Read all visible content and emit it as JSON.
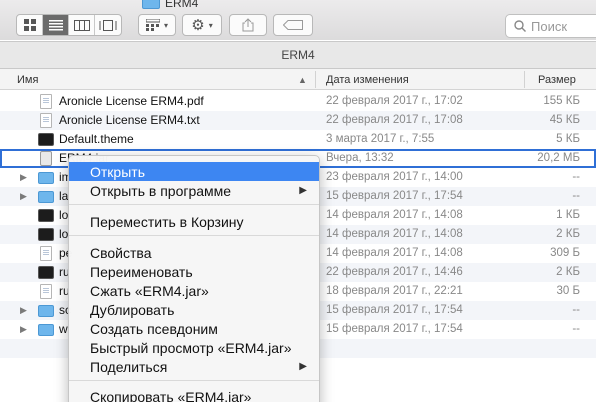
{
  "window": {
    "folder_title": "ERM4",
    "path_title": "ERM4",
    "search_placeholder": "Поиск"
  },
  "columns": {
    "name": "Имя",
    "date": "Дата изменения",
    "size": "Размер"
  },
  "files": [
    {
      "name": "Aronicle License ERM4.pdf",
      "date": "22 февраля 2017 г., 17:02",
      "size": "155 КБ",
      "icon": "pdf-icon",
      "expandable": false
    },
    {
      "name": "Aronicle License ERM4.txt",
      "date": "22 февраля 2017 г., 17:08",
      "size": "45 КБ",
      "icon": "text-icon",
      "expandable": false
    },
    {
      "name": "Default.theme",
      "date": "3 марта 2017 г., 7:55",
      "size": "5 КБ",
      "icon": "terminal-icon",
      "expandable": false
    },
    {
      "name": "ERM4.jar",
      "date": "Вчера, 13:32",
      "size": "20,2 МБ",
      "icon": "jar-icon",
      "expandable": false
    },
    {
      "name": "im",
      "date": "23 февраля 2017 г., 14:00",
      "size": "--",
      "icon": "folder-icon",
      "expandable": true
    },
    {
      "name": "la",
      "date": "15 февраля 2017 г., 17:54",
      "size": "--",
      "icon": "folder-icon",
      "expandable": true
    },
    {
      "name": "lo",
      "date": "14 февраля 2017 г., 14:08",
      "size": "1 КБ",
      "icon": "terminal-icon",
      "expandable": false
    },
    {
      "name": "lo",
      "date": "14 февраля 2017 г., 14:08",
      "size": "2 КБ",
      "icon": "terminal-icon",
      "expandable": false
    },
    {
      "name": "pe",
      "date": "14 февраля 2017 г., 14:08",
      "size": "309 Б",
      "icon": "text-icon",
      "expandable": false
    },
    {
      "name": "ru",
      "date": "22 февраля 2017 г., 14:46",
      "size": "2 КБ",
      "icon": "terminal-icon",
      "expandable": false
    },
    {
      "name": "ru",
      "date": "18 февраля 2017 г., 22:21",
      "size": "30 Б",
      "icon": "text-icon",
      "expandable": false
    },
    {
      "name": "sc",
      "date": "15 февраля 2017 г., 17:54",
      "size": "--",
      "icon": "folder-icon",
      "expandable": true
    },
    {
      "name": "w",
      "date": "15 февраля 2017 г., 17:54",
      "size": "--",
      "icon": "folder-icon",
      "expandable": true
    }
  ],
  "context_menu": {
    "open": "Открыть",
    "open_with": "Открыть в программе",
    "move_to_trash": "Переместить в Корзину",
    "get_info": "Свойства",
    "rename": "Переименовать",
    "compress": "Сжать «ERM4.jar»",
    "duplicate": "Дублировать",
    "make_alias": "Создать псевдоним",
    "quick_look": "Быстрый просмотр «ERM4.jar»",
    "share": "Поделиться",
    "copy": "Скопировать «ERM4.jar»"
  },
  "colors": {
    "highlight": "#3d86f2",
    "selection_outline": "#2f6fd6",
    "folder": "#6eb6ec"
  }
}
